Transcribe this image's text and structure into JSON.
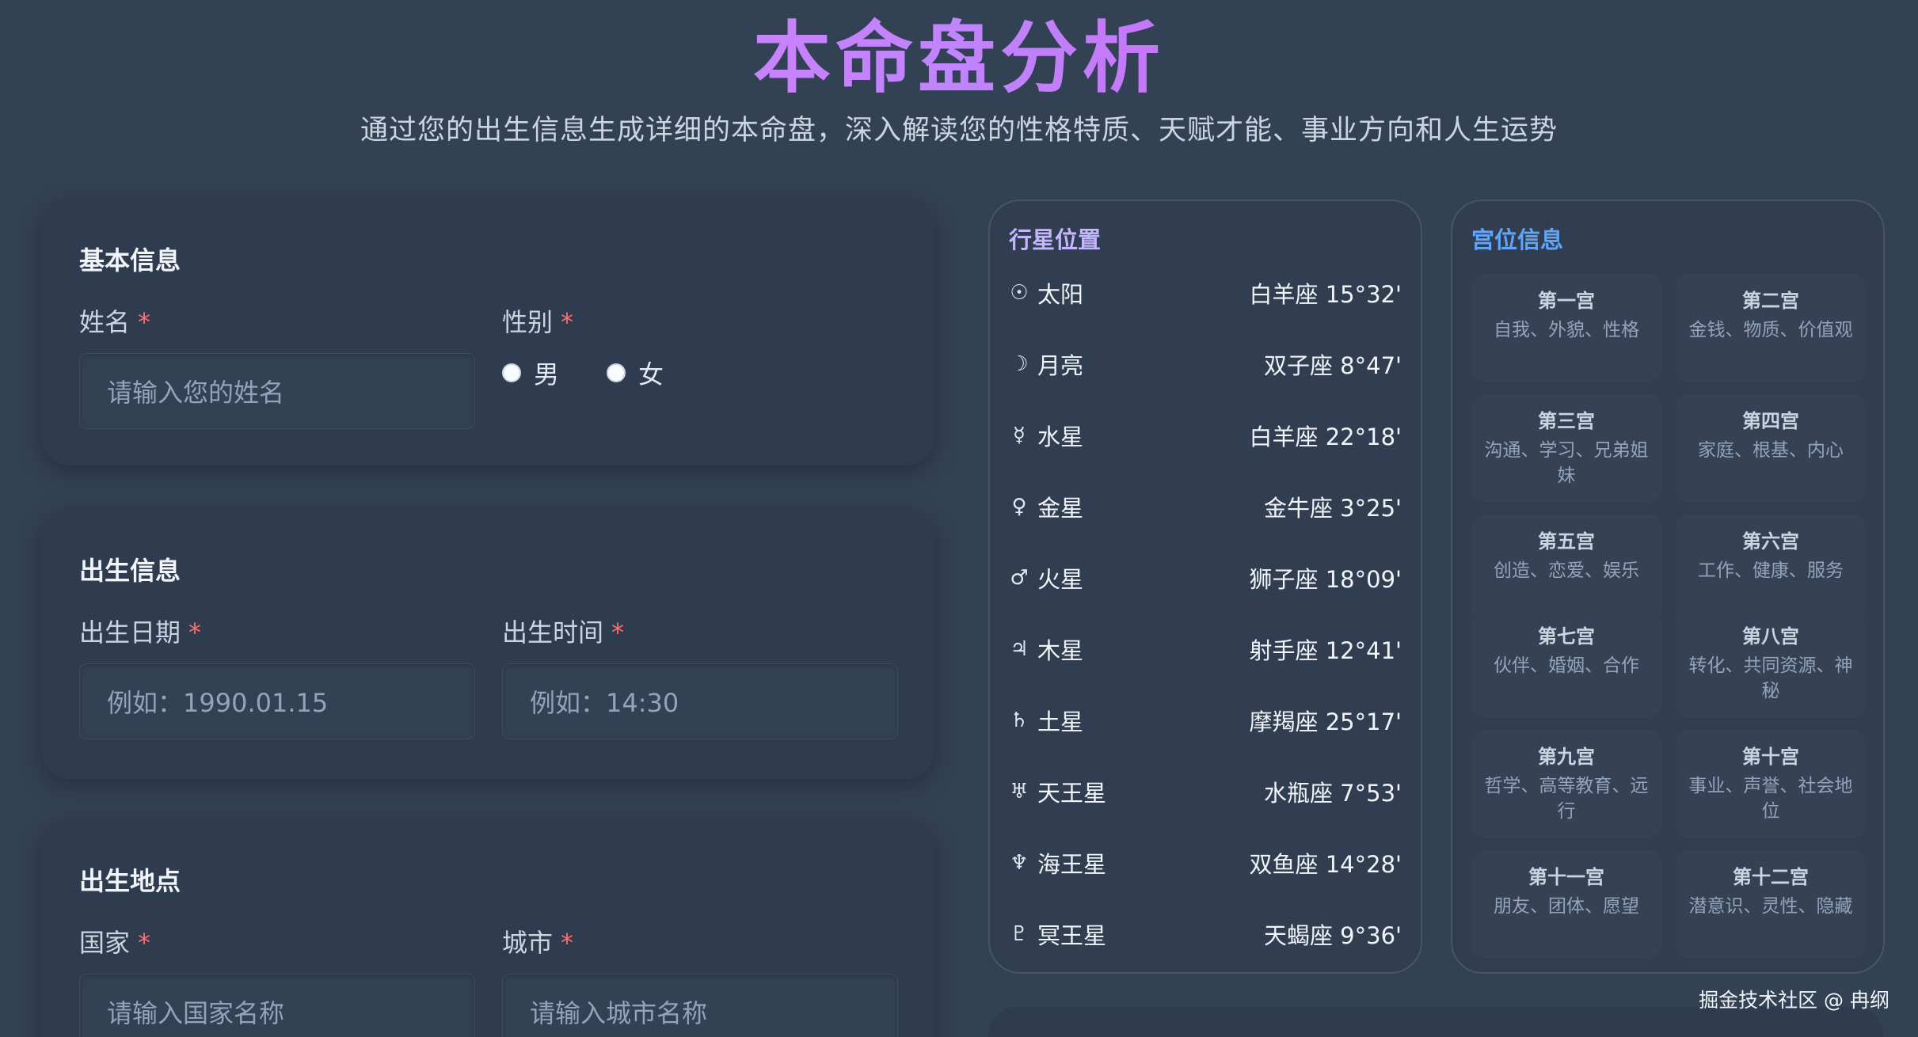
{
  "header": {
    "title": "本命盘分析",
    "subtitle": "通过您的出生信息生成详细的本命盘，深入解读您的性格特质、天赋才能、事业方向和人生运势"
  },
  "basic_info": {
    "title": "基本信息",
    "name_label": "姓名",
    "name_placeholder": "请输入您的姓名",
    "gender_label": "性别",
    "gender_options": [
      "男",
      "女"
    ],
    "required_mark": "*"
  },
  "birth_info": {
    "title": "出生信息",
    "date_label": "出生日期",
    "date_placeholder": "例如：1990.01.15",
    "time_label": "出生时间",
    "time_placeholder": "例如：14:30"
  },
  "birth_place": {
    "title": "出生地点",
    "country_label": "国家",
    "country_placeholder": "请输入国家名称",
    "city_label": "城市",
    "city_placeholder": "请输入城市名称"
  },
  "planets": {
    "title": "行星位置",
    "title_color": "#c4b5fd",
    "items": [
      {
        "symbol": "☉",
        "name": "太阳",
        "position": "白羊座 15°32'"
      },
      {
        "symbol": "☽",
        "name": "月亮",
        "position": "双子座 8°47'"
      },
      {
        "symbol": "☿",
        "name": "水星",
        "position": "白羊座 22°18'"
      },
      {
        "symbol": "♀",
        "name": "金星",
        "position": "金牛座 3°25'"
      },
      {
        "symbol": "♂",
        "name": "火星",
        "position": "狮子座 18°09'"
      },
      {
        "symbol": "♃",
        "name": "木星",
        "position": "射手座 12°41'"
      },
      {
        "symbol": "♄",
        "name": "土星",
        "position": "摩羯座 25°17'"
      },
      {
        "symbol": "♅",
        "name": "天王星",
        "position": "水瓶座 7°53'"
      },
      {
        "symbol": "♆",
        "name": "海王星",
        "position": "双鱼座 14°28'"
      },
      {
        "symbol": "♇",
        "name": "冥王星",
        "position": "天蝎座 9°36'"
      }
    ]
  },
  "houses": {
    "title": "宫位信息",
    "title_color": "#60a5fa",
    "items": [
      {
        "name": "第一宫",
        "desc": "自我、外貌、性格"
      },
      {
        "name": "第二宫",
        "desc": "金钱、物质、价值观"
      },
      {
        "name": "第三宫",
        "desc": "沟通、学习、兄弟姐妹"
      },
      {
        "name": "第四宫",
        "desc": "家庭、根基、内心"
      },
      {
        "name": "第五宫",
        "desc": "创造、恋爱、娱乐"
      },
      {
        "name": "第六宫",
        "desc": "工作、健康、服务"
      },
      {
        "name": "第七宫",
        "desc": "伙伴、婚姻、合作"
      },
      {
        "name": "第八宫",
        "desc": "转化、共同资源、神秘"
      },
      {
        "name": "第九宫",
        "desc": "哲学、高等教育、远行"
      },
      {
        "name": "第十宫",
        "desc": "事业、声誉、社会地位"
      },
      {
        "name": "第十一宫",
        "desc": "朋友、团体、愿望"
      },
      {
        "name": "第十二宫",
        "desc": "潜意识、灵性、隐藏"
      }
    ]
  },
  "watermark": "掘金技术社区 @ 冉纲"
}
